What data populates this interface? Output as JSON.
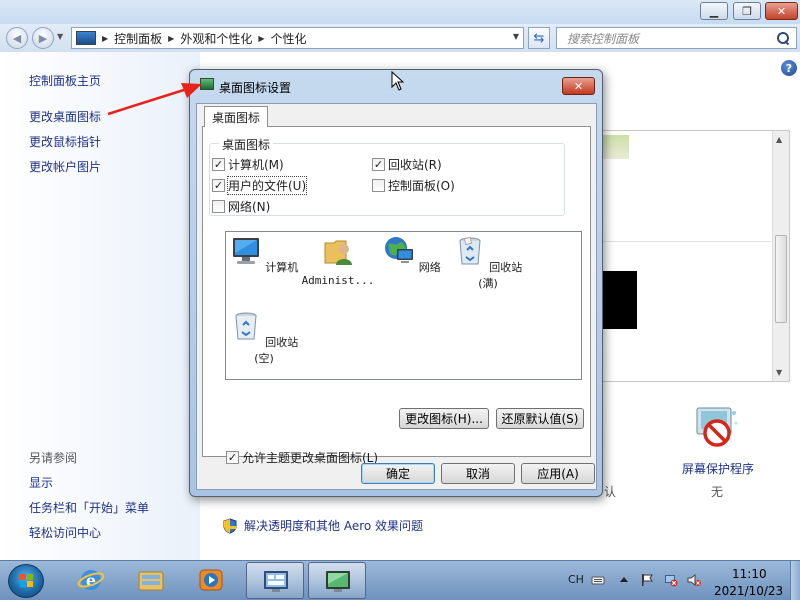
{
  "breadcrumb": [
    "控制面板",
    "外观和个性化",
    "个性化"
  ],
  "search": {
    "placeholder": "搜索控制面板"
  },
  "sidebar": {
    "home": "控制面板主页",
    "items": [
      "更改桌面图标",
      "更改鼠标指针",
      "更改帐户图片"
    ],
    "see_also": "另请参阅",
    "see_also_items": [
      "显示",
      "任务栏和「开始」菜单",
      "轻松访问中心"
    ]
  },
  "main": {
    "screensaver_label": "屏幕保护程序",
    "screensaver_value": "无",
    "bg_default_fragment": "认",
    "aero_link": "解决透明度和其他 Aero 效果问题"
  },
  "dialog": {
    "title": "桌面图标设置",
    "tab": "桌面图标",
    "group_label": "桌面图标",
    "checkboxes": [
      {
        "label": "计算机(M)",
        "checked": true
      },
      {
        "label": "回收站(R)",
        "checked": true
      },
      {
        "label": "用户的文件(U)",
        "checked": true
      },
      {
        "label": "控制面板(O)",
        "checked": false
      },
      {
        "label": "网络(N)",
        "checked": false
      }
    ],
    "icons": [
      "计算机",
      "Administ...",
      "网络",
      "回收站(满)",
      "回收站(空)"
    ],
    "change_icon": "更改图标(H)...",
    "restore_default": "还原默认值(S)",
    "allow_themes": "允许主题更改桌面图标(L)",
    "allow_themes_checked": true,
    "ok": "确定",
    "cancel": "取消",
    "apply": "应用(A)"
  },
  "taskbar": {
    "language": "CH",
    "time": "11:10",
    "date": "2021/10/23"
  },
  "colors": {
    "accent_link": "#1e3287",
    "annotation_arrow": "#e8221b"
  }
}
